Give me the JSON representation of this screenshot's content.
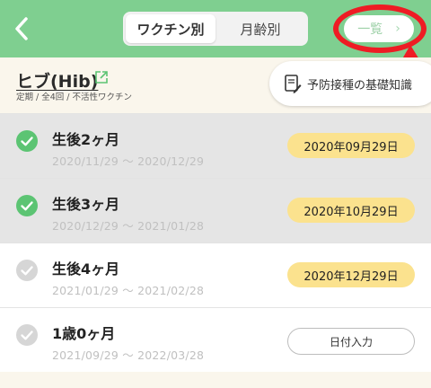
{
  "header": {
    "back_icon": "chevron-left-icon",
    "tabs": [
      {
        "label": "ワクチン別",
        "active": true
      },
      {
        "label": "月齢別",
        "active": false
      }
    ],
    "list_button": {
      "label": "一覧",
      "icon": "chevron-right-icon"
    },
    "colors": {
      "header_bg": "#7fcf90",
      "annotation_red": "#ee1c24"
    }
  },
  "vaccine": {
    "name": "ヒブ(Hib)",
    "info": "定期 / 全4回 / 不活性ワクチン",
    "link_icon": "external-link-icon"
  },
  "knowledge_button": {
    "label": "予防接種の基礎知識",
    "icon": "notebook-icon"
  },
  "doses": [
    {
      "age": "生後2ヶ月",
      "range": "2020/11/29 ～ 2020/12/29",
      "date": "2020年09月29日",
      "done": true
    },
    {
      "age": "生後3ヶ月",
      "range": "2020/12/29 ～ 2021/01/28",
      "date": "2020年10月29日",
      "done": true
    },
    {
      "age": "生後4ヶ月",
      "range": "2021/01/29 ～ 2021/02/28",
      "date": "2020年12月29日",
      "done": false
    },
    {
      "age": "1歳0ヶ月",
      "range": "2021/09/29 ～ 2022/03/28",
      "date": "",
      "done": false
    }
  ],
  "date_input_label": "日付入力",
  "colors": {
    "done_row": "#e5e5e5",
    "check_done": "#5cc473",
    "check_pending": "#d6d6d6",
    "date_pill": "#fbe28e"
  }
}
